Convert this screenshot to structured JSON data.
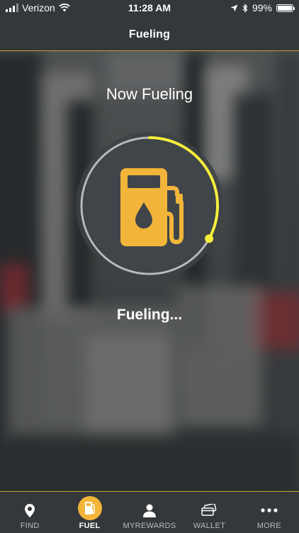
{
  "status_bar": {
    "carrier": "Verizon",
    "time": "11:28 AM",
    "battery": "99%",
    "battery_level": 0.99
  },
  "header": {
    "title": "Fueling"
  },
  "main": {
    "heading": "Now Fueling",
    "status": "Fueling...",
    "progress": 0.33
  },
  "colors": {
    "accent": "#f2b53a",
    "progress_arc": "#f5ee3c",
    "track": "#b7b9ba",
    "disc": "#404549"
  },
  "tabbar": {
    "tabs": [
      {
        "label": "FIND",
        "icon": "location-pin-icon"
      },
      {
        "label": "FUEL",
        "icon": "fuel-pump-icon",
        "active": true
      },
      {
        "label": "MYREWARDS",
        "icon": "user-icon"
      },
      {
        "label": "WALLET",
        "icon": "wallet-cards-icon"
      },
      {
        "label": "MORE",
        "icon": "more-dots-icon"
      }
    ]
  }
}
